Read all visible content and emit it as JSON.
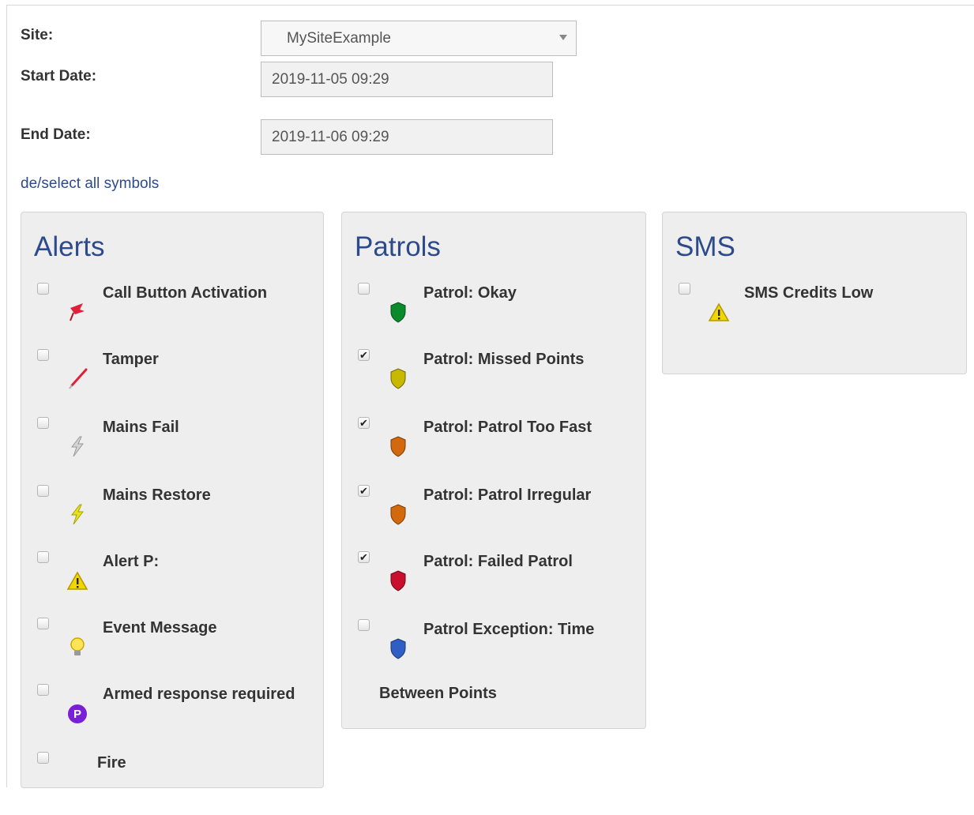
{
  "form": {
    "site_label": "Site:",
    "site_value": "MySiteExample",
    "start_label": "Start Date:",
    "start_value": "2019-11-05 09:29",
    "end_label": "End Date:",
    "end_value": "2019-11-06 09:29",
    "deselect_link": "de/select all symbols"
  },
  "panels": {
    "alerts": {
      "title": "Alerts",
      "items": [
        {
          "label": "Call Button Activation",
          "checked": false,
          "icon": "red-pushpin-icon"
        },
        {
          "label": "Tamper",
          "checked": false,
          "icon": "red-needle-icon"
        },
        {
          "label": "Mains Fail",
          "checked": false,
          "icon": "gray-lightning-icon"
        },
        {
          "label": "Mains Restore",
          "checked": false,
          "icon": "yellow-lightning-icon"
        },
        {
          "label": "Alert P:",
          "checked": false,
          "icon": "warning-triangle-icon"
        },
        {
          "label": "Event Message",
          "checked": false,
          "icon": "lightbulb-icon"
        },
        {
          "label": "Armed response required",
          "checked": false,
          "icon": "purple-p-circle-icon"
        },
        {
          "label": "Fire",
          "checked": false,
          "icon": ""
        }
      ]
    },
    "patrols": {
      "title": "Patrols",
      "items": [
        {
          "label": "Patrol: Okay",
          "checked": false,
          "icon": "green-shield-icon"
        },
        {
          "label": "Patrol: Missed Points",
          "checked": true,
          "icon": "yellow-shield-icon"
        },
        {
          "label": "Patrol: Patrol Too Fast",
          "checked": true,
          "icon": "orange-shield-icon"
        },
        {
          "label": "Patrol: Patrol Irregular",
          "checked": true,
          "icon": "orange-shield-icon"
        },
        {
          "label": "Patrol: Failed Patrol",
          "checked": true,
          "icon": "red-shield-icon"
        },
        {
          "label": "Patrol Exception: Time",
          "checked": false,
          "icon": "blue-shield-icon"
        }
      ],
      "wrap_text": "Between Points"
    },
    "sms": {
      "title": "SMS",
      "items": [
        {
          "label": "SMS Credits Low",
          "checked": false,
          "icon": "warning-triangle-icon"
        }
      ]
    }
  },
  "colors": {
    "link": "#2d4a8a",
    "panel_bg": "#eeeeee",
    "shield_green": "#0a8a2a",
    "shield_yellow": "#c9b800",
    "shield_orange": "#d2690e",
    "shield_red": "#c8102e",
    "shield_blue": "#2f5fc4"
  }
}
